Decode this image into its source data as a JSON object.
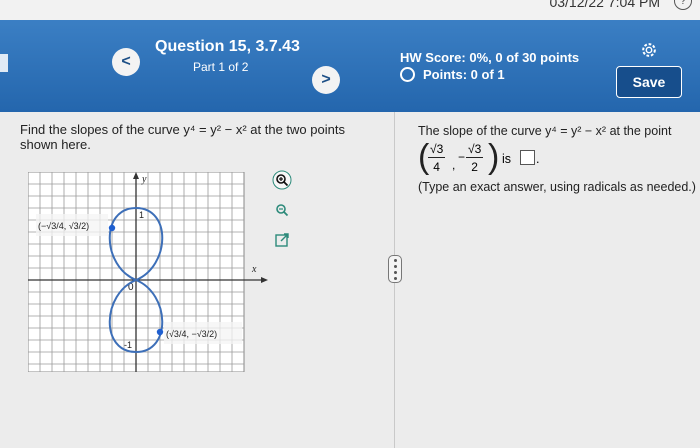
{
  "status": {
    "clock": "03/12/22 7:04 PM",
    "help_icon": "?"
  },
  "header": {
    "prev_label": "<",
    "next_label": ">",
    "question_title": "Question 15, 3.7.43",
    "part": "Part 1 of 2",
    "hw_score": "HW Score: 0%, 0 of 30 points",
    "points": "Points: 0 of 1",
    "save_label": "Save",
    "gear_icon": "gear-icon"
  },
  "problem": {
    "line1": "Find the slopes of the curve y⁴ = y² − x² at the two points",
    "line2": "shown here."
  },
  "graph": {
    "y_label": "y",
    "x_label": "x",
    "origin_label": "0",
    "tick_pos1": "1",
    "tick_neg1": "-1",
    "point_left_label": "(−√3/4, √3/2)",
    "point_right_label": "(√3/4, −√3/2)"
  },
  "tools": [
    "zoom-in-icon",
    "zoom-out-icon",
    "expand-icon"
  ],
  "answer": {
    "prompt": "The slope of the curve y⁴ = y² − x² at the point",
    "x_num": "√3",
    "x_den": "4",
    "y_sign": "−",
    "y_num": "√3",
    "y_den": "2",
    "comma": ",",
    "is_label": "is",
    "period": ".",
    "hint": "(Type an exact answer, using radicals as needed.)"
  },
  "colors": {
    "header": "#2a6db3",
    "curve": "#3d6fb8",
    "point": "#1f5fd0",
    "save": "#174e8c"
  }
}
